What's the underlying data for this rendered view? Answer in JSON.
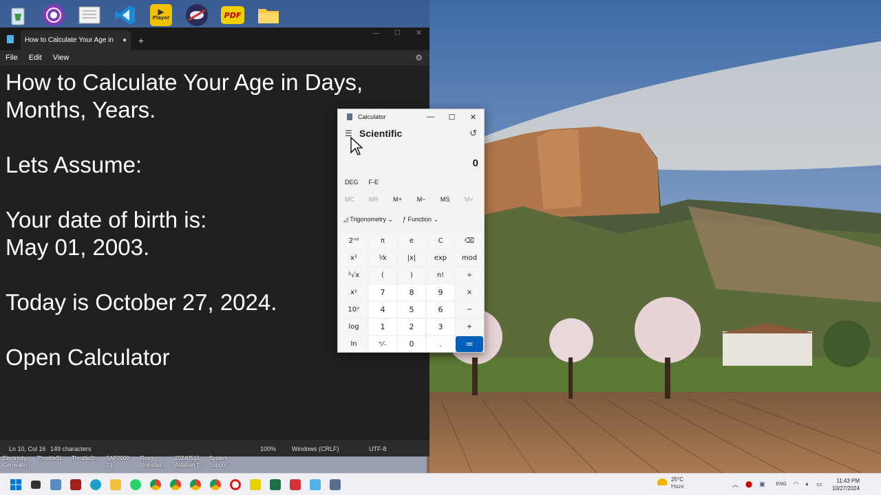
{
  "desktop": {
    "icons": [
      "recycle-bin-icon",
      "tor-browser-icon",
      "document-icon",
      "vscode-icon",
      "potplayer-icon",
      "opera-gx-icon",
      "pdf-reader-icon",
      "folder-icon"
    ],
    "player_label": "Player",
    "pdf_label": "PDF",
    "shortcut_labels": [
      "Electricity Generatin...",
      "ThrottleSt...",
      "ThrottleSt...",
      "SAP2000 23",
      "Revo Uninstall...",
      "20240510 Asfahan T...",
      "System Suppo..."
    ]
  },
  "notepad": {
    "tab_title": "How to Calculate Your Age in D",
    "tab_dot": "●",
    "new_tab": "+",
    "menu": [
      "File",
      "Edit",
      "View"
    ],
    "content": "How to Calculate Your Age in Days,\nMonths, Years.\n\nLets Assume:\n\nYour date of birth is:\nMay 01, 2003.\n\nToday is October 27, 2024.\n\nOpen Calculator",
    "status": {
      "position": "Ln 10, Col 16",
      "characters": "149 characters",
      "zoom": "100%",
      "line_ending": "Windows (CRLF)",
      "encoding": "UTF-8"
    }
  },
  "calculator": {
    "title": "Calculator",
    "mode": "Scientific",
    "display": "0",
    "deg": "DEG",
    "fe": "F-E",
    "memory": [
      "MC",
      "MR",
      "M+",
      "M−",
      "MS",
      "M˅"
    ],
    "trig": "Trigonometry ⌄",
    "func": "ƒ  Function ⌄",
    "keys": [
      [
        "2ⁿᵈ",
        "π",
        "e",
        "C",
        "⌫"
      ],
      [
        "x²",
        "¹⁄x",
        "|x|",
        "exp",
        "mod"
      ],
      [
        "²√x",
        "(",
        ")",
        "n!",
        "÷"
      ],
      [
        "xʸ",
        "7",
        "8",
        "9",
        "×"
      ],
      [
        "10ˣ",
        "4",
        "5",
        "6",
        "−"
      ],
      [
        "log",
        "1",
        "2",
        "3",
        "+"
      ],
      [
        "ln",
        "⁺⁄₋",
        "0",
        ".",
        "="
      ]
    ]
  },
  "taskbar": {
    "weather_temp": "25°C",
    "weather_cond": "Haze",
    "lang": "ENG",
    "time": "11:43 PM",
    "date": "10/27/2024"
  },
  "colors": {
    "notepad_bg": "#202020",
    "accent_equals": "#005fb8",
    "taskbar": "#eef0f3"
  }
}
